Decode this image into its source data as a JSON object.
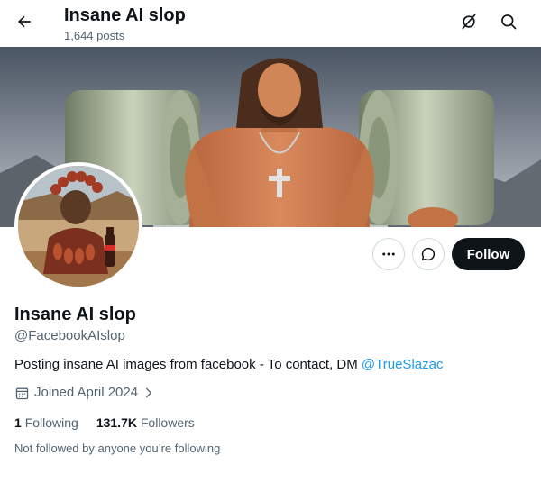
{
  "header": {
    "title": "Insane AI slop",
    "posts_count": "1,644 posts"
  },
  "profile": {
    "name": "Insane AI slop",
    "handle": "@FacebookAIslop",
    "bio_text": "Posting insane AI images from facebook - To contact, DM ",
    "bio_mention": "@TrueSlazac",
    "joined": "Joined April 2024",
    "following_count": "1",
    "following_label": "Following",
    "followers_count": "131.7K",
    "followers_label": "Followers",
    "not_followed_text": "Not followed by anyone you’re following"
  },
  "actions": {
    "follow_label": "Follow"
  },
  "icons": {
    "back": "arrow-left-icon",
    "grok": "grok-icon",
    "search": "search-icon",
    "more": "more-icon",
    "message": "message-icon",
    "calendar": "calendar-icon",
    "chevron": "chevron-right-icon"
  },
  "colors": {
    "accent_link": "#1d9bf0",
    "follow_button_bg": "#0f1419",
    "secondary_text": "#536471"
  }
}
